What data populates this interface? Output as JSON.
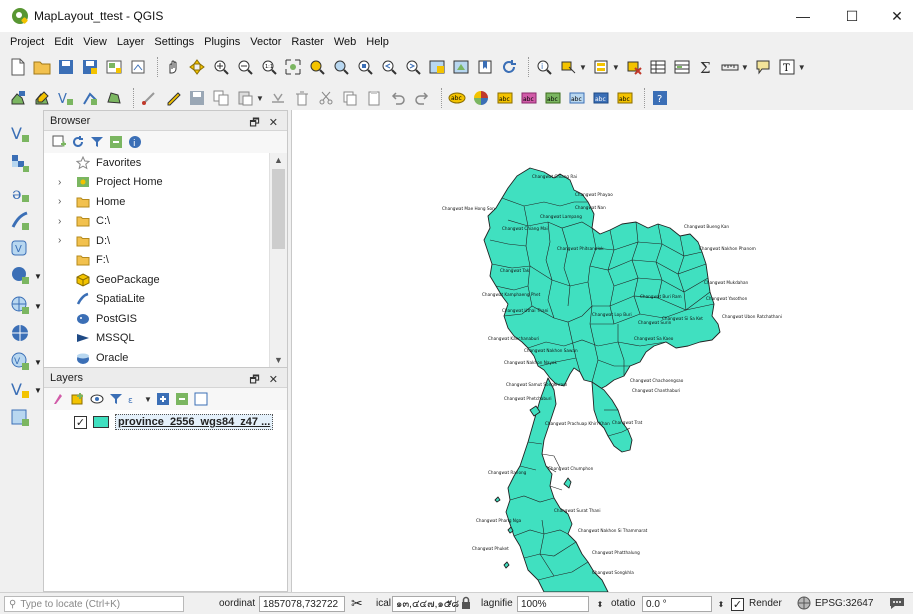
{
  "window": {
    "title": "MapLayout_ttest - QGIS",
    "minimize": "—",
    "maximize": "☐",
    "close": "✕"
  },
  "menu": [
    "Project",
    "Edit",
    "View",
    "Layer",
    "Settings",
    "Plugins",
    "Vector",
    "Raster",
    "Web",
    "Help"
  ],
  "browser": {
    "title": "Browser",
    "items": [
      {
        "label": "Favorites",
        "expandable": false,
        "icon": "star-icon"
      },
      {
        "label": "Project Home",
        "expandable": true,
        "icon": "project-home-icon"
      },
      {
        "label": "Home",
        "expandable": true,
        "icon": "folder-icon"
      },
      {
        "label": "C:\\",
        "expandable": true,
        "icon": "folder-icon"
      },
      {
        "label": "D:\\",
        "expandable": true,
        "icon": "folder-icon"
      },
      {
        "label": "F:\\",
        "expandable": false,
        "icon": "folder-icon"
      },
      {
        "label": "GeoPackage",
        "expandable": false,
        "icon": "geopackage-icon"
      },
      {
        "label": "SpatiaLite",
        "expandable": false,
        "icon": "spatialite-icon"
      },
      {
        "label": "PostGIS",
        "expandable": false,
        "icon": "postgis-icon"
      },
      {
        "label": "MSSQL",
        "expandable": false,
        "icon": "mssql-icon"
      },
      {
        "label": "Oracle",
        "expandable": false,
        "icon": "oracle-icon"
      }
    ]
  },
  "layers": {
    "title": "Layers",
    "items": [
      {
        "name": "province_2556_wgs84_z47 ...",
        "checked": true,
        "fill": "#40e0c0"
      }
    ]
  },
  "map": {
    "fill": "#40e0c0",
    "labels": [
      "Changwat Chiang Rai",
      "Changwat Mae Hong Son",
      "Changwat Phayao",
      "Changwat Nan",
      "Changwat Lampang",
      "Changwat Bueng Kan",
      "Changwat Nakhon Phanom",
      "Changwat Tak",
      "Changwat Mukdahan",
      "Changwat Phitsanulok",
      "Changwat Yasothon",
      "Changwat Kamphaeng Phet",
      "Changwat Ubon Ratchathani",
      "Changwat Uthai Thani",
      "Changwat Buri Ram",
      "Changwat Lop Buri",
      "Changwat Surin",
      "Changwat Si Sa Ket",
      "Changwat Kanchanaburi",
      "Changwat Nakhon Nayok",
      "Changwat Sa Kaeo",
      "Changwat Chachoengsao",
      "Changwat Samut Songkhram",
      "Changwat Chanthaburi",
      "Changwat Phetchaburi",
      "Changwat Prachuap Khiri Khan",
      "Changwat Trat",
      "Changwat Chumphon",
      "Changwat Ranong",
      "Changwat Surat Thani",
      "Changwat Phang Nga",
      "Changwat Nakhon Si Thammarat",
      "Changwat Phuket",
      "Changwat Phatthalung",
      "Changwat Songkhla",
      "Changwat Chiang Mai",
      "Changwat Nakhon Sawan"
    ]
  },
  "status": {
    "locator_placeholder": "Type to locate (Ctrl+K)",
    "coord_label": "oordinat",
    "coord_value": "1857078,732722",
    "scale_label": "ical",
    "scale_value": "๑๓,๔๔๗,๑๕๘",
    "magnifier_label": "lagnifie",
    "magnifier_value": "100%",
    "rotation_label": "otatio",
    "rotation_value": "0.0 °",
    "render_label": "Render",
    "crs": "EPSG:32647"
  }
}
